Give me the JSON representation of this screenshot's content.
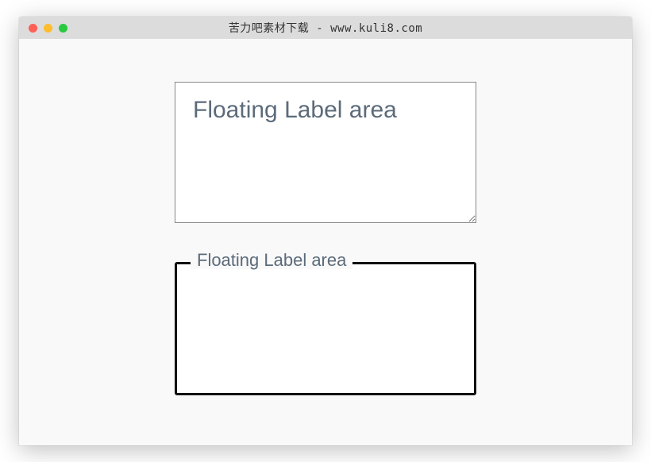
{
  "window": {
    "title": "苦力吧素材下载 - www.kuli8.com"
  },
  "fields": {
    "textarea_top": {
      "placeholder": "Floating Label area",
      "value": ""
    },
    "textarea_bottom": {
      "label": "Floating Label area",
      "value": ""
    }
  }
}
